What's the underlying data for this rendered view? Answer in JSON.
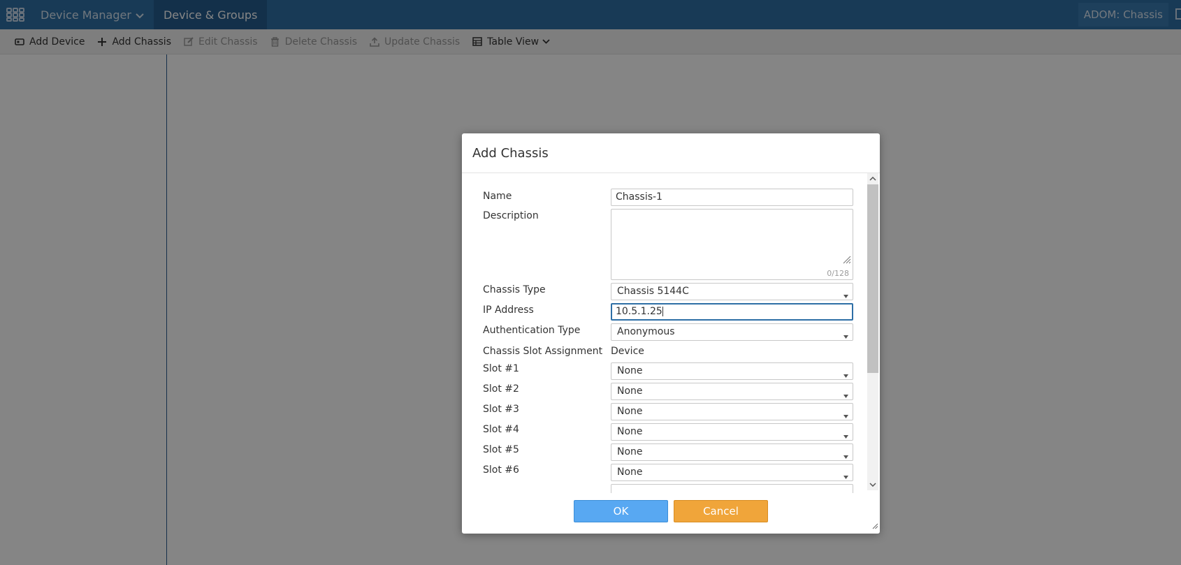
{
  "topbar": {
    "nav": [
      {
        "label": "Device Manager",
        "has_dropdown": true
      },
      {
        "label": "Device & Groups",
        "active": true
      }
    ],
    "adom_label": "ADOM: Chassis"
  },
  "toolbar": {
    "buttons": [
      {
        "label": "Add Device",
        "icon": "device-icon",
        "enabled": true
      },
      {
        "label": "Add Chassis",
        "icon": "plus-icon",
        "enabled": true
      },
      {
        "label": "Edit Chassis",
        "icon": "edit-icon",
        "enabled": false
      },
      {
        "label": "Delete Chassis",
        "icon": "trash-icon",
        "enabled": false
      },
      {
        "label": "Update Chassis",
        "icon": "upload-icon",
        "enabled": false
      },
      {
        "label": "Table View",
        "icon": "table-icon",
        "enabled": true,
        "has_dropdown": true
      }
    ]
  },
  "dialog": {
    "title": "Add Chassis",
    "form": {
      "name_label": "Name",
      "name_value": "Chassis-1",
      "description_label": "Description",
      "description_value": "",
      "description_counter": "0/128",
      "chassis_type_label": "Chassis Type",
      "chassis_type_value": "Chassis 5144C",
      "ip_label": "IP Address",
      "ip_value": "10.5.1.25",
      "auth_label": "Authentication Type",
      "auth_value": "Anonymous",
      "slot_assignment_label": "Chassis Slot Assignment",
      "slot_assignment_header": "Device",
      "slots": [
        {
          "label": "Slot #1",
          "value": "None"
        },
        {
          "label": "Slot #2",
          "value": "None"
        },
        {
          "label": "Slot #3",
          "value": "None"
        },
        {
          "label": "Slot #4",
          "value": "None"
        },
        {
          "label": "Slot #5",
          "value": "None"
        },
        {
          "label": "Slot #6",
          "value": "None"
        }
      ]
    },
    "ok_label": "OK",
    "cancel_label": "Cancel"
  },
  "colors": {
    "topbar": "#2e6fa6",
    "ok_button": "#58a8f2",
    "cancel_button": "#f0a53a"
  }
}
